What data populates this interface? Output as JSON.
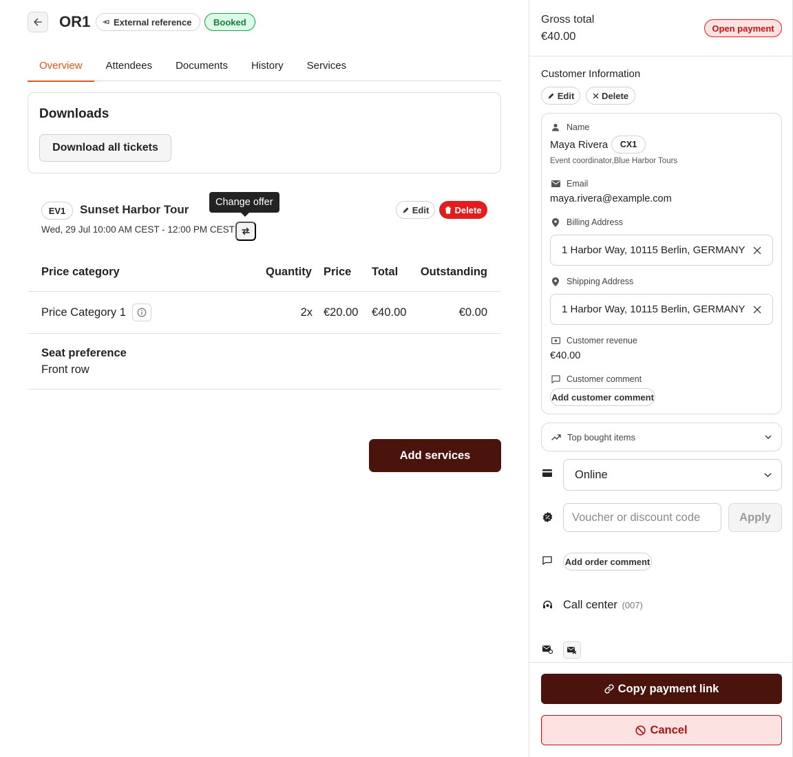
{
  "header": {
    "order_id": "OR1",
    "external_reference_label": "External reference",
    "status_badge": "Booked"
  },
  "tabs": [
    {
      "label": "Overview",
      "active": true
    },
    {
      "label": "Attendees",
      "active": false
    },
    {
      "label": "Documents",
      "active": false
    },
    {
      "label": "History",
      "active": false
    },
    {
      "label": "Services",
      "active": false
    }
  ],
  "downloads": {
    "title": "Downloads",
    "download_all_label": "Download all tickets"
  },
  "event": {
    "badge": "EV1",
    "title": "Sunset Harbor Tour",
    "date_range": "Wed, 29 Jul 10:00 AM CEST - 12:00 PM CEST",
    "tooltip": "Change offer",
    "edit_label": "Edit",
    "delete_label": "Delete"
  },
  "price_table": {
    "headers": [
      "Price category",
      "Quantity",
      "Price",
      "Total",
      "Outstanding"
    ],
    "rows": [
      {
        "category": "Price Category 1",
        "quantity": "2x",
        "price": "€20.00",
        "total": "€40.00",
        "outstanding": "€0.00"
      }
    ]
  },
  "seat_preference": {
    "label": "Seat preference",
    "value": "Front row"
  },
  "add_services_label": "Add services",
  "panel": {
    "gross_total_label": "Gross total",
    "gross_total_value": "€40.00",
    "payment_status": "Open payment",
    "customer_info_title": "Customer Information",
    "edit_label": "Edit",
    "delete_label": "Delete",
    "customer": {
      "name_label": "Name",
      "name": "Maya Rivera",
      "customer_badge": "CX1",
      "role": "Event coordinator,Blue Harbor Tours",
      "email_label": "Email",
      "email": "maya.rivera@example.com",
      "billing_label": "Billing Address",
      "billing_address": "1 Harbor Way, 10115 Berlin, GERMANY",
      "shipping_label": "Shipping Address",
      "shipping_address": "1 Harbor Way, 10115 Berlin, GERMANY",
      "revenue_label": "Customer revenue",
      "revenue": "€40.00",
      "comment_label": "Customer comment",
      "add_comment_label": "Add customer comment"
    },
    "top_bought_label": "Top bought items",
    "payment_method": "Online",
    "voucher_placeholder": "Voucher or discount code",
    "apply_label": "Apply",
    "add_order_comment_label": "Add order comment",
    "sales_channel": "Call center",
    "sales_channel_code": "(007)",
    "copy_payment_link_label": "Copy payment link",
    "cancel_label": "Cancel"
  },
  "colors": {
    "accent_tab": "#e0561d",
    "primary_button": "#4a130b",
    "booked_green": "#15803d",
    "danger_red": "#e11d1d"
  }
}
